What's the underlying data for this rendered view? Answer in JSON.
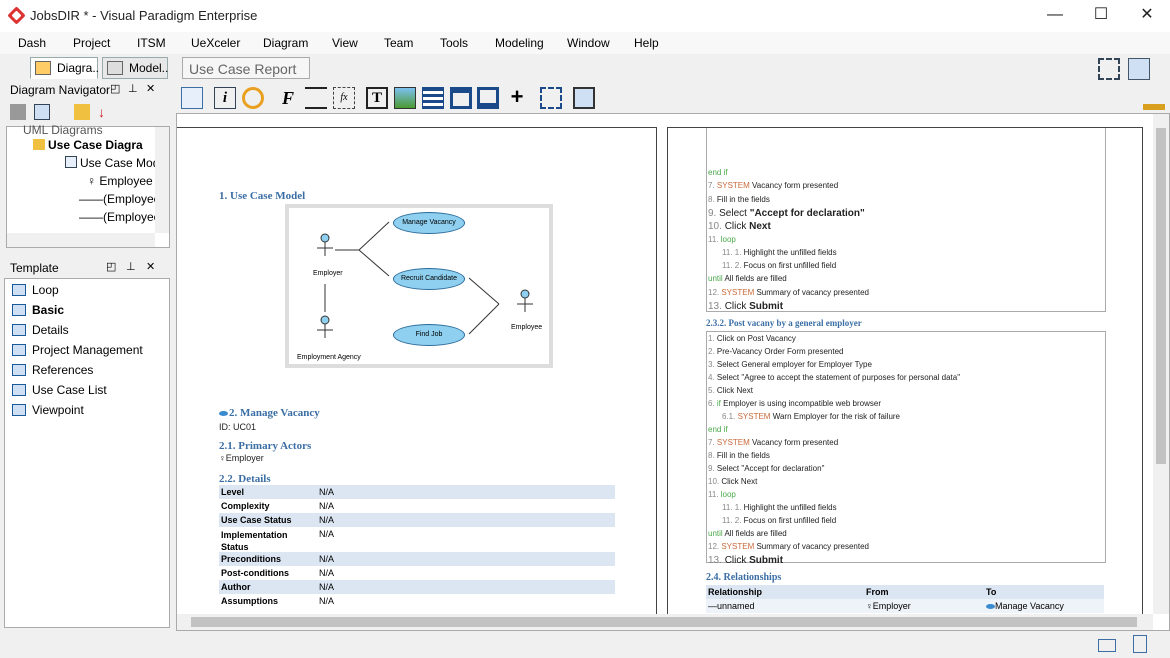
{
  "window": {
    "title": "JobsDIR * - Visual Paradigm Enterprise",
    "minimize": "—",
    "maximize": "☐",
    "close": "✕"
  },
  "menu": [
    "Dash",
    "Project",
    "ITSM",
    "UeXceler",
    "Diagram",
    "View",
    "Team",
    "Tools",
    "Modeling",
    "Window",
    "Help"
  ],
  "nav_tabs": [
    {
      "label": "Diagra.."
    },
    {
      "label": "Model.."
    }
  ],
  "report_tab": {
    "label": "Use Case Report"
  },
  "diagram_navigator": {
    "title": "Diagram Navigator",
    "tree": [
      "UML Diagrams",
      "Use Case Diagra",
      "Use Case Mode",
      "Employee",
      "(Employee",
      "(Employee"
    ]
  },
  "template_panel": {
    "title": "Template",
    "items": [
      "Loop",
      "Basic",
      "Details",
      "Project Management",
      "References",
      "Use Case List",
      "Viewpoint"
    ]
  },
  "report_left": {
    "h1": "1. Use Case Model",
    "diagram": {
      "usecases": [
        "Manage Vacancy",
        "Recruit Candidate",
        "Find Job"
      ],
      "actors": [
        "Employer",
        "Employment Agency",
        "Employee"
      ]
    },
    "h2": "2. Manage Vacancy",
    "id_line": "ID: UC01",
    "h21": "2.1. Primary Actors",
    "primary_actor": "Employer",
    "h22": "2.2. Details",
    "details": [
      {
        "k": "Level",
        "v": "N/A"
      },
      {
        "k": "Complexity",
        "v": "N/A"
      },
      {
        "k": "Use Case Status",
        "v": "N/A"
      },
      {
        "k": "Implementation Status",
        "v": "N/A"
      },
      {
        "k": "Preconditions",
        "v": "N/A"
      },
      {
        "k": "Post-conditions",
        "v": "N/A"
      },
      {
        "k": "Author",
        "v": "N/A"
      },
      {
        "k": "Assumptions",
        "v": "N/A"
      }
    ]
  },
  "report_right": {
    "flow1": [
      {
        "n": "",
        "kg": "end if",
        "t": ""
      },
      {
        "n": "7.",
        "kw": "SYSTEM",
        "t": " Vacancy form presented"
      },
      {
        "n": "8.",
        "t": "Fill in the fields"
      },
      {
        "n": "9.",
        "t": "Select ",
        "b": "\"Accept for declaration\"",
        "big": true
      },
      {
        "n": "10.",
        "t": "Click ",
        "b": "Next",
        "big": true
      },
      {
        "n": "11.",
        "kg": "loop",
        "t": ""
      },
      {
        "n": "11. 1.",
        "t": "Highlight the unfilled fields",
        "indent": true
      },
      {
        "n": "11. 2.",
        "t": "Focus on first unfilled field",
        "indent": true
      },
      {
        "n": "",
        "kg": "until",
        "t": " All fields are filled"
      },
      {
        "n": "12.",
        "kw": "SYSTEM",
        "t": " Summary of vacancy presented"
      },
      {
        "n": "13.",
        "t": "Click ",
        "b": "Submit",
        "big": true
      }
    ],
    "h232": "2.3.2. Post vacany by a general employer",
    "flow2": [
      {
        "n": "1.",
        "t": "Click on Post Vacancy"
      },
      {
        "n": "2.",
        "t": "Pre-Vacancy Order Form presented"
      },
      {
        "n": "3.",
        "t": "Select General employer for Employer Type"
      },
      {
        "n": "4.",
        "t": "Select \"Agree to accept the statement of purposes for personal data\""
      },
      {
        "n": "5.",
        "t": "Click Next"
      },
      {
        "n": "6.",
        "kg": "if",
        "t": " Employer is using incompatible web browser"
      },
      {
        "n": "6.1.",
        "kw": "SYSTEM",
        "t": " Warn Employer for the risk of failure",
        "indent": true
      },
      {
        "n": "",
        "kg": "end if",
        "t": ""
      },
      {
        "n": "7.",
        "kw": "SYSTEM",
        "t": " Vacancy form presented"
      },
      {
        "n": "8.",
        "t": "Fill in the fields"
      },
      {
        "n": "9.",
        "t": "Select \"Accept for declaration\""
      },
      {
        "n": "10.",
        "t": "Click Next"
      },
      {
        "n": "11.",
        "kg": "loop",
        "t": ""
      },
      {
        "n": "11. 1.",
        "t": "Highlight the unfilled fields",
        "indent": true
      },
      {
        "n": "11. 2.",
        "t": "Focus on first unfilled field",
        "indent": true
      },
      {
        "n": "",
        "kg": "until",
        "t": " All fields are filled"
      },
      {
        "n": "12.",
        "kw": "SYSTEM",
        "t": " Summary of vacancy presented"
      },
      {
        "n": "13.",
        "t": "Click ",
        "b": "Submit",
        "big": true
      }
    ],
    "h24": "2.4. Relationships",
    "rel_headers": [
      "Relationship",
      "From",
      "To"
    ],
    "rel_rows": [
      [
        "unnamed",
        "Employer",
        "Manage Vacancy"
      ]
    ]
  }
}
